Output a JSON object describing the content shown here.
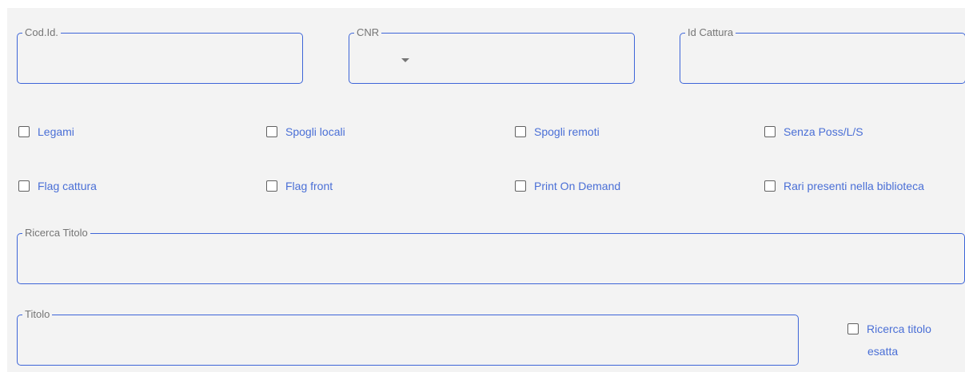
{
  "fields": {
    "cod_id": {
      "label": "Cod.Id.",
      "value": ""
    },
    "cnr": {
      "label": "CNR",
      "value": ""
    },
    "id_cattura": {
      "label": "Id Cattura",
      "value": ""
    },
    "ricerca_titolo": {
      "label": "Ricerca Titolo",
      "value": ""
    },
    "titolo": {
      "label": "Titolo",
      "value": ""
    }
  },
  "checkboxes": {
    "legami": {
      "label": "Legami",
      "checked": false
    },
    "spogli_locali": {
      "label": "Spogli locali",
      "checked": false
    },
    "spogli_remoti": {
      "label": "Spogli remoti",
      "checked": false
    },
    "senza_poss": {
      "label": "Senza Poss/L/S",
      "checked": false
    },
    "flag_cattura": {
      "label": "Flag cattura",
      "checked": false
    },
    "flag_front": {
      "label": "Flag front",
      "checked": false
    },
    "print_on_demand": {
      "label": "Print On Demand",
      "checked": false
    },
    "rari_presenti": {
      "label": "Rari presenti nella biblioteca",
      "checked": false
    },
    "ricerca_titolo_esatta": {
      "label_line1": "Ricerca titolo",
      "label_line2": "esatta",
      "checked": false
    }
  },
  "colors": {
    "accent": "#3d65d8",
    "label_text": "#4a6fd6",
    "panel_bg": "#f3f3f3"
  }
}
